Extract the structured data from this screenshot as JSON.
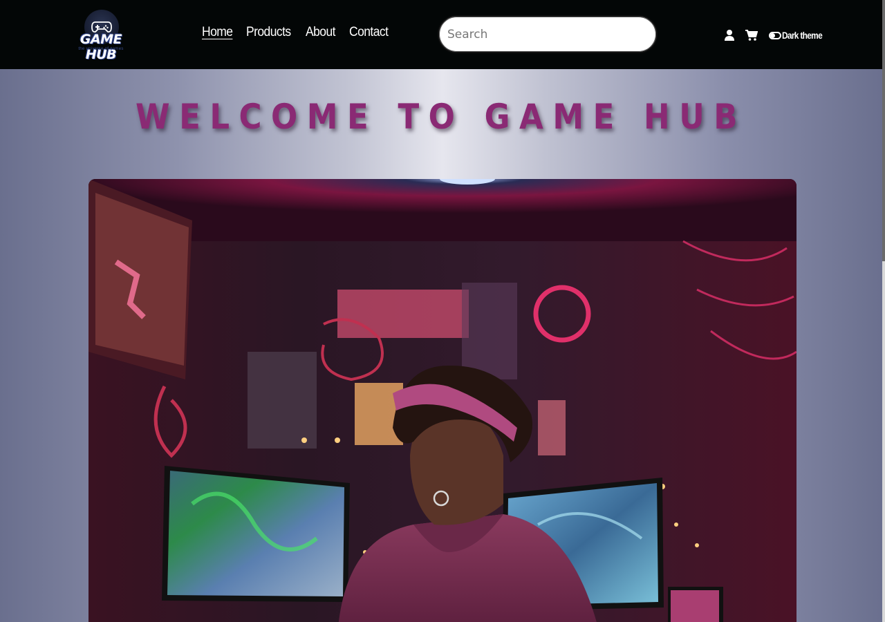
{
  "navbar": {
    "logo": {
      "text": "GAME HUB",
      "tagline": "the universe of games",
      "icon": "gamepad-icon"
    },
    "links": [
      {
        "label": "Home",
        "active": true
      },
      {
        "label": "Products",
        "active": false
      },
      {
        "label": "About",
        "active": false
      },
      {
        "label": "Contact",
        "active": false
      }
    ],
    "search": {
      "placeholder": "Search",
      "value": ""
    },
    "icons": {
      "user": "user-icon",
      "cart": "cart-icon",
      "toggle": "toggle-switch-icon"
    },
    "theme_toggle_label": "Dark theme"
  },
  "hero": {
    "title": "WELCOME TO GAME HUB",
    "image_alt": "Gamer with headband in neon-lit room facing monitors"
  },
  "colors": {
    "navbar_bg": "#030606",
    "title_color": "#8a2a74",
    "neon_pink": "#e0306a"
  }
}
